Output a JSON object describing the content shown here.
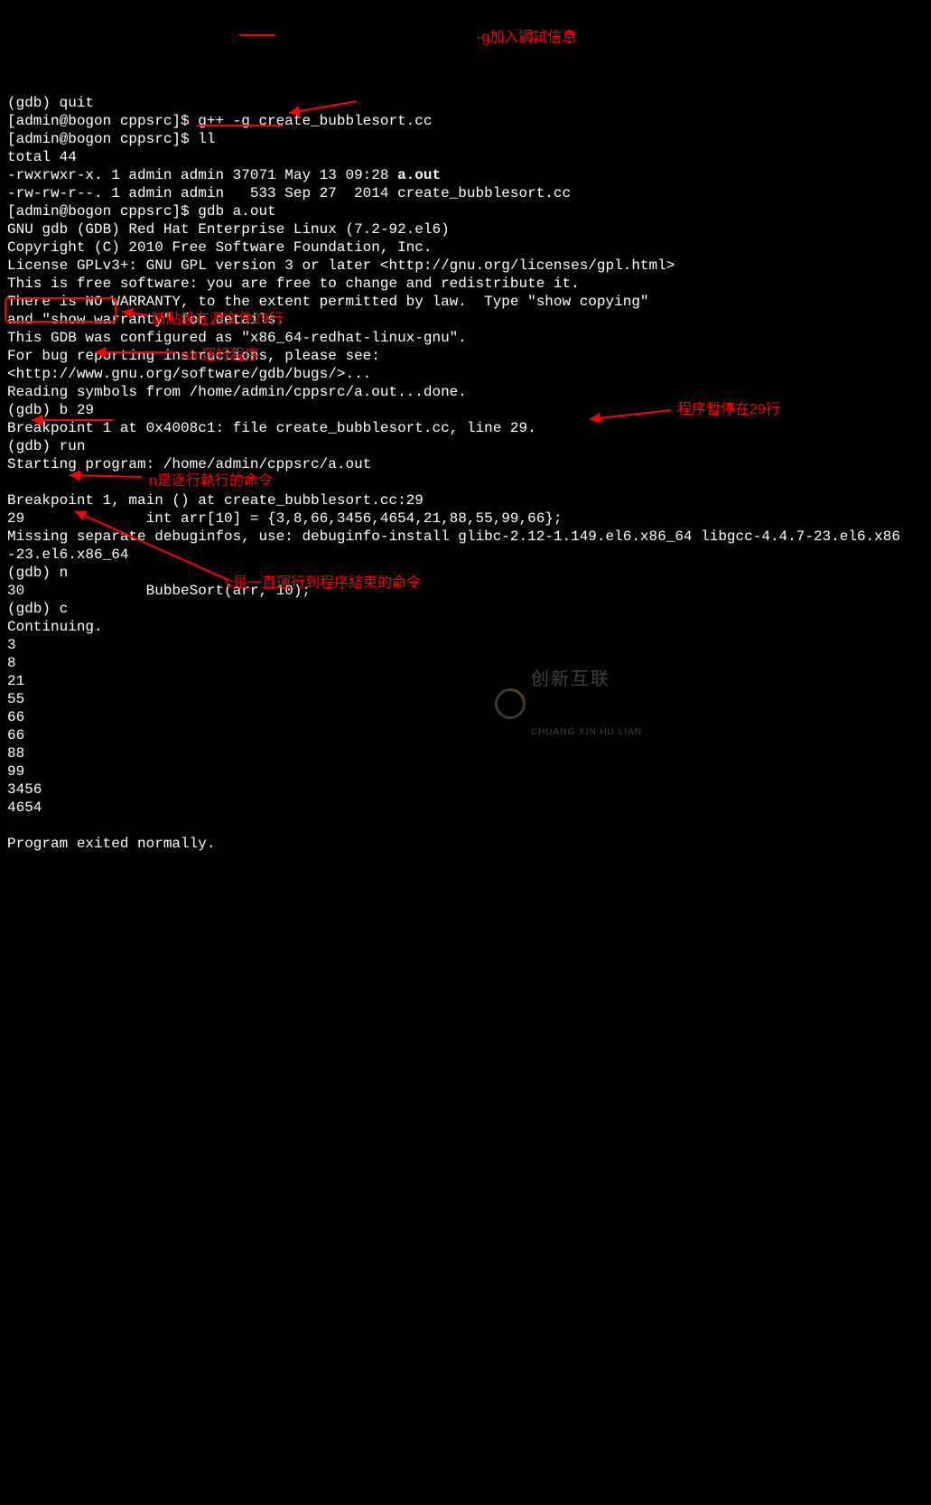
{
  "lines": {
    "l0": "(gdb) quit",
    "l1_prompt": "[admin@bogon cppsrc]$ ",
    "l1_cmd": "g++ -g create_bubblesort.cc",
    "l2_prompt": "[admin@bogon cppsrc]$ ",
    "l2_cmd": "ll",
    "l3": "total 44",
    "l4a": "-rwxrwxr-x. 1 admin admin 37071 May 13 09:28 ",
    "l4b": "a.out",
    "l5": "-rw-rw-r--. 1 admin admin   533 Sep 27  2014 create_bubblesort.cc",
    "l6_prompt": "[admin@bogon cppsrc]$ ",
    "l6_cmd": "gdb a.out",
    "l7": "GNU gdb (GDB) Red Hat Enterprise Linux (7.2-92.el6)",
    "l8": "Copyright (C) 2010 Free Software Foundation, Inc.",
    "l9": "License GPLv3+: GNU GPL version 3 or later <http://gnu.org/licenses/gpl.html>",
    "l10": "This is free software: you are free to change and redistribute it.",
    "l11": "There is NO WARRANTY, to the extent permitted by law.  Type \"show copying\"",
    "l12": "and \"show warranty\" for details.",
    "l13": "This GDB was configured as \"x86_64-redhat-linux-gnu\".",
    "l14": "For bug reporting instructions, please see:",
    "l15": "<http://www.gnu.org/software/gdb/bugs/>...",
    "l16": "Reading symbols from /home/admin/cppsrc/a.out...done.",
    "l17": "(gdb) b 29",
    "l18": "Breakpoint 1 at 0x4008c1: file create_bubblesort.cc, line 29.",
    "l19": "(gdb) run",
    "l20": "Starting program: /home/admin/cppsrc/a.out",
    "l21": "",
    "l22": "Breakpoint 1, main () at create_bubblesort.cc:29",
    "l23": "29              int arr[10] = {3,8,66,3456,4654,21,88,55,99,66};",
    "l24": "Missing separate debuginfos, use: debuginfo-install glibc-2.12-1.149.el6.x86_64 libgcc-4.4.7-23.el6.x86",
    "l25": "-23.el6.x86_64",
    "l26": "(gdb) n",
    "l27": "30              BubbeSort(arr, 10);",
    "l28": "(gdb) c",
    "l29": "Continuing.",
    "l30": "3",
    "l31": "8",
    "l32": "21",
    "l33": "55",
    "l34": "66",
    "l35": "66",
    "l36": "88",
    "l37": "99",
    "l38": "3456",
    "l39": "4654",
    "l40": "",
    "l41": "Program exited normally."
  },
  "annotations": {
    "a1": "-g加入調試信息",
    "a2": "斷點設在源文件29行",
    "a3": "run運行程序",
    "a4": "程序暫停在29行",
    "a5": "n是逐行執行的命令",
    "a6": "c是一直運行到程序結束的命令"
  },
  "watermark": {
    "name": "创新互联",
    "sub": "CHUANG XIN HU LIAN"
  }
}
